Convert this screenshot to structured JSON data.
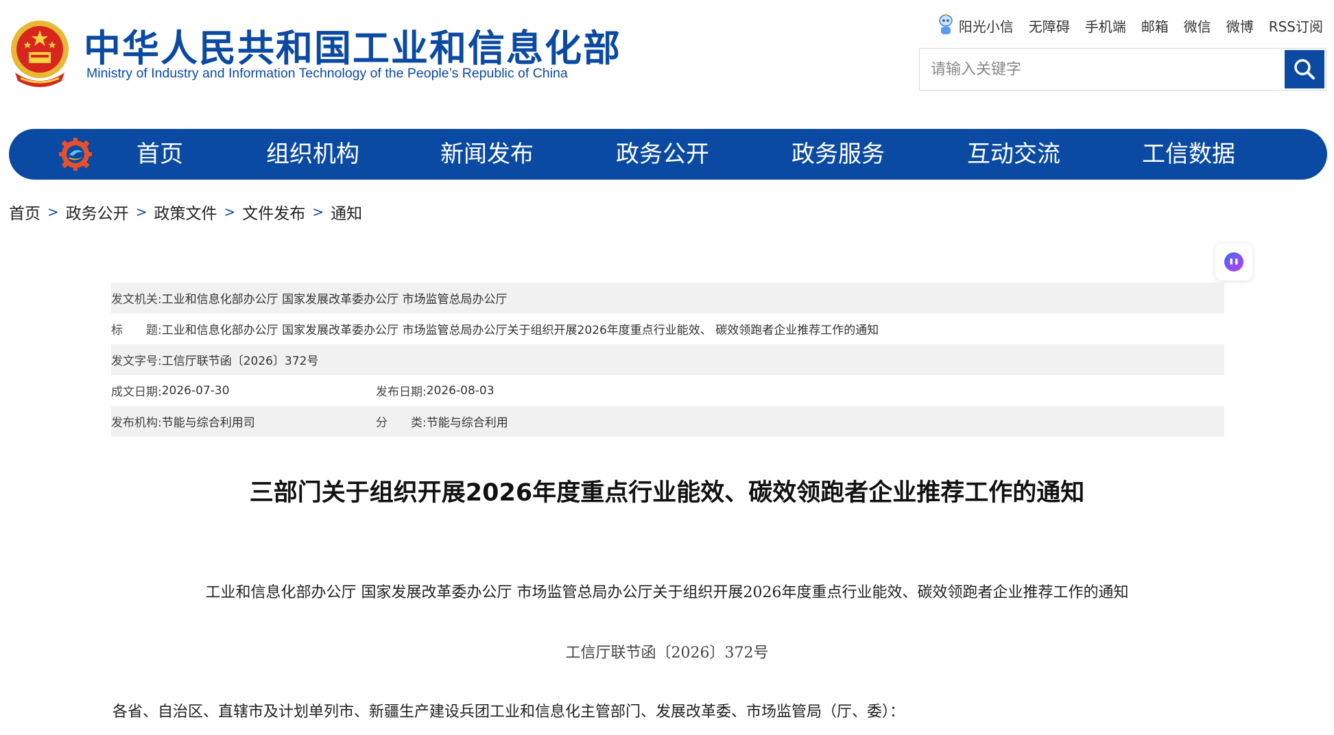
{
  "header": {
    "title_cn": "中华人民共和国工业和信息化部",
    "title_en": "Ministry of Industry and Information Technology of the People’s Republic of China",
    "top_links": [
      "阳光小信",
      "无障碍",
      "手机端",
      "邮箱",
      "微信",
      "微博",
      "RSS订阅"
    ],
    "search_placeholder": "请输入关键字"
  },
  "nav": {
    "items": [
      "首页",
      "组织机构",
      "新闻发布",
      "政务公开",
      "政务服务",
      "互动交流",
      "工信数据"
    ]
  },
  "breadcrumb": [
    "首页",
    "政务公开",
    "政策文件",
    "文件发布",
    "通知"
  ],
  "breadcrumb_separator": ">",
  "meta": {
    "issuer_label": "发文机关:",
    "issuer_value": "工业和信息化部办公厅 国家发展改革委办公厅 市场监管总局办公厅",
    "title_label": "标　　题:",
    "title_value": "工业和信息化部办公厅 国家发展改革委办公厅 市场监管总局办公厅关于组织开展2026年度重点行业能效、 碳效领跑者企业推荐工作的通知",
    "docno_label": "发文字号:",
    "docno_value": "工信厅联节函〔2026〕372号",
    "created_label": "成文日期:",
    "created_value": "2026-07-30",
    "published_label": "发布日期:",
    "published_value": "2026-08-03",
    "org_label": "发布机构:",
    "org_value": "节能与综合利用司",
    "category_label": "分　　类:",
    "category_value": "节能与综合利用"
  },
  "article": {
    "title": "三部门关于组织开展2026年度重点行业能效、碳效领跑者企业推荐工作的通知",
    "subtitle": "工业和信息化部办公厅  国家发展改革委办公厅  市场监管总局办公厅关于组织开展2026年度重点行业能效、碳效领跑者企业推荐工作的通知",
    "doc_number": "工信厅联节函〔2026〕372号",
    "salutation": "各省、自治区、直辖市及计划单列市、新疆生产建设兵团工业和信息化主管部门、发展改革委、市场监管局（厅、委）："
  },
  "colors": {
    "brand_blue": "#0b4aa2",
    "emblem_red": "#d7261e",
    "emblem_gold": "#f2c232",
    "meta_shade": "#f1f1f1"
  },
  "icons": [
    "national-emblem-icon",
    "robot-assistant-icon",
    "search-icon",
    "gear-logo-icon",
    "ai-assistant-icon"
  ]
}
